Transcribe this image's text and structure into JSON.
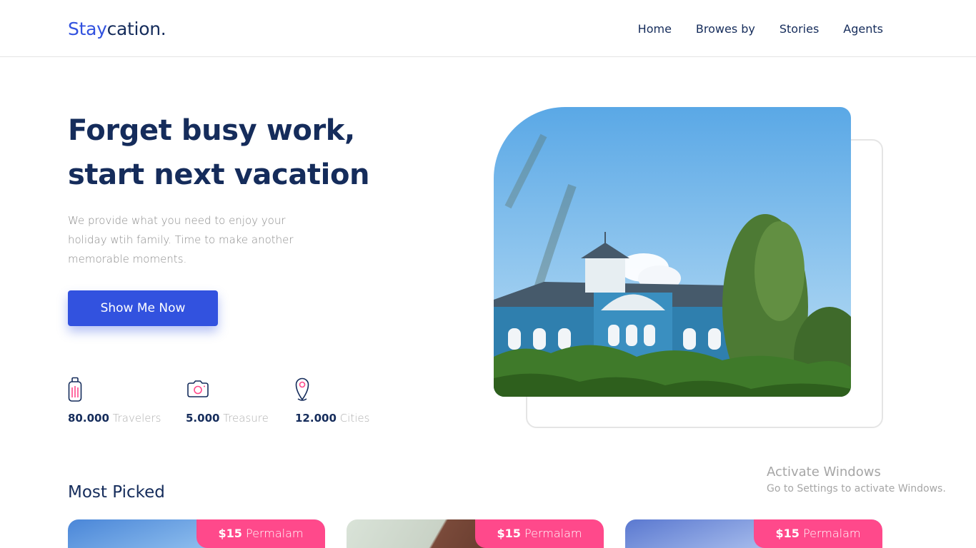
{
  "header": {
    "brand_part1": "Stay",
    "brand_part2": "cation.",
    "nav": [
      "Home",
      "Browes by",
      "Stories",
      "Agents"
    ]
  },
  "hero": {
    "title_line1": "Forget busy work,",
    "title_line2": "start next vacation",
    "description": "We provide what you need to enjoy your holiday wtih family. Time to make another memorable moments.",
    "cta_label": "Show Me Now",
    "stats": [
      {
        "icon": "suitcase-icon",
        "value": "80.000",
        "label": "Travelers"
      },
      {
        "icon": "camera-icon",
        "value": "5.000",
        "label": "Treasure"
      },
      {
        "icon": "map-pin-icon",
        "value": "12.000",
        "label": "Cities"
      }
    ]
  },
  "most_picked": {
    "title": "Most Picked",
    "cards": [
      {
        "price": "$15",
        "unit": "Permalam"
      },
      {
        "price": "$15",
        "unit": "Permalam"
      },
      {
        "price": "$15",
        "unit": "Permalam"
      }
    ]
  },
  "watermark": {
    "line1": "Activate Windows",
    "line2": "Go to Settings to activate Windows."
  },
  "colors": {
    "primary": "#3252df",
    "navy": "#152c5b",
    "accent_pink": "#ff498b",
    "muted": "#b0b0b0"
  }
}
